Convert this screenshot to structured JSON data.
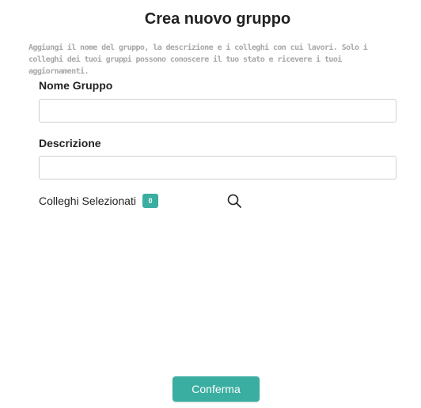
{
  "dialog": {
    "title": "Crea nuovo gruppo",
    "description": "Aggiungi il nome del gruppo, la descrizione e i colleghi con cui lavori. Solo i colleghi dei tuoi gruppi possono conoscere il tuo stato e ricevere i tuoi aggiornamenti."
  },
  "form": {
    "name_label": "Nome Gruppo",
    "name_value": "",
    "description_label": "Descrizione",
    "description_value": ""
  },
  "colleagues": {
    "label": "Colleghi Selezionati",
    "count": "0",
    "search_icon": "search-icon"
  },
  "actions": {
    "confirm_label": "Conferma"
  },
  "colors": {
    "accent": "#3aaea1",
    "muted_text": "#a8a8a8",
    "border": "#cfcfcf"
  }
}
